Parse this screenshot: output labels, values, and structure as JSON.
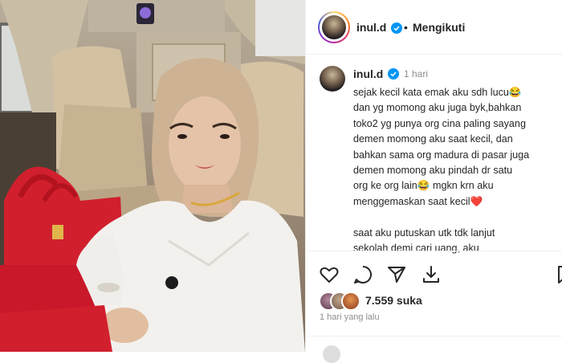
{
  "post": {
    "username": "inul.d",
    "follow_status": "Mengikuti",
    "separator": "•",
    "more_icon": "more-horizontal-icon",
    "verified_color": "#0095f6"
  },
  "comment": {
    "username": "inul.d",
    "time": "1 hari",
    "caption": "sejak kecil kata emak aku sdh lucu😂\ndan yg momong aku juga byk,bahkan\ntoko2 yg punya org cina paling sayang\ndemen momong aku saat kecil, dan\nbahkan sama org madura di pasar juga\ndemen momong aku pindah dr satu\norg ke org lain😂 mgkn krn aku\nmenggemaskan saat kecil❤️\n\nsaat aku putuskan utk tdk lanjut\nsekolah demi cari uang, aku"
  },
  "actions": {
    "like_icon": "heart-icon",
    "comment_icon": "comment-icon",
    "share_icon": "send-icon",
    "save_icon": "download-icon",
    "bookmark_icon": "bookmark-icon"
  },
  "engagement": {
    "likes": "7.559 suka",
    "date": "1 hari yang lalu"
  },
  "colors": {
    "text": "#262626",
    "secondary": "#8e8e8e",
    "border": "#efefef",
    "heart": "#ed4956"
  }
}
